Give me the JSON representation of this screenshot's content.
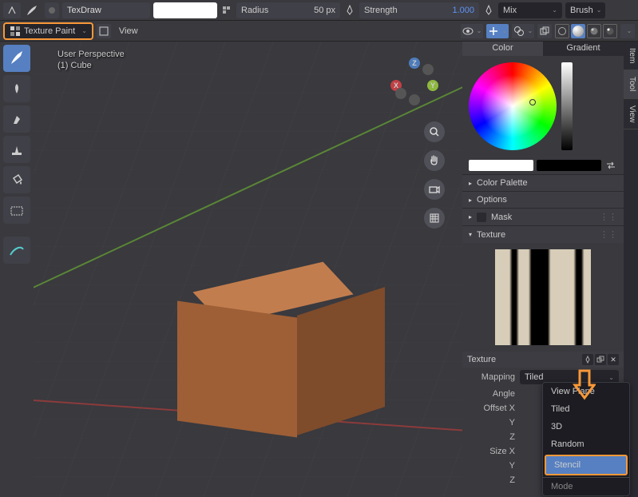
{
  "top_toolbar": {
    "brush_name": "TexDraw",
    "radius_label": "Radius",
    "radius_value": "50 px",
    "strength_label": "Strength",
    "strength_value": "1.000",
    "mix_label": "Mix",
    "brush_label": "Brush"
  },
  "second_toolbar": {
    "mode": "Texture Paint",
    "view_menu": "View"
  },
  "viewport": {
    "perspective": "User Perspective",
    "object": "(1) Cube",
    "gizmo": {
      "x": "X",
      "y": "Y",
      "z": "Z"
    }
  },
  "right_tabs": {
    "color": "Color",
    "gradient": "Gradient",
    "side": {
      "item": "Item",
      "tool": "Tool",
      "view": "View"
    }
  },
  "panels": {
    "color_palette": "Color Palette",
    "options": "Options",
    "mask": "Mask",
    "texture": "Texture",
    "texture_label": "Texture"
  },
  "properties": {
    "mapping_label": "Mapping",
    "mapping_value": "Tiled",
    "angle_label": "Angle",
    "offset_x_label": "Offset X",
    "y_label": "Y",
    "z_label": "Z",
    "size_x_label": "Size X"
  },
  "dropdown": {
    "items": [
      "View Plane",
      "Tiled",
      "3D",
      "Random",
      "Stencil"
    ],
    "selected": "Stencil",
    "mode_header": "Mode"
  },
  "icons": {
    "snap": "snap-icon",
    "brush": "brush-icon",
    "dot": "dot-icon"
  }
}
